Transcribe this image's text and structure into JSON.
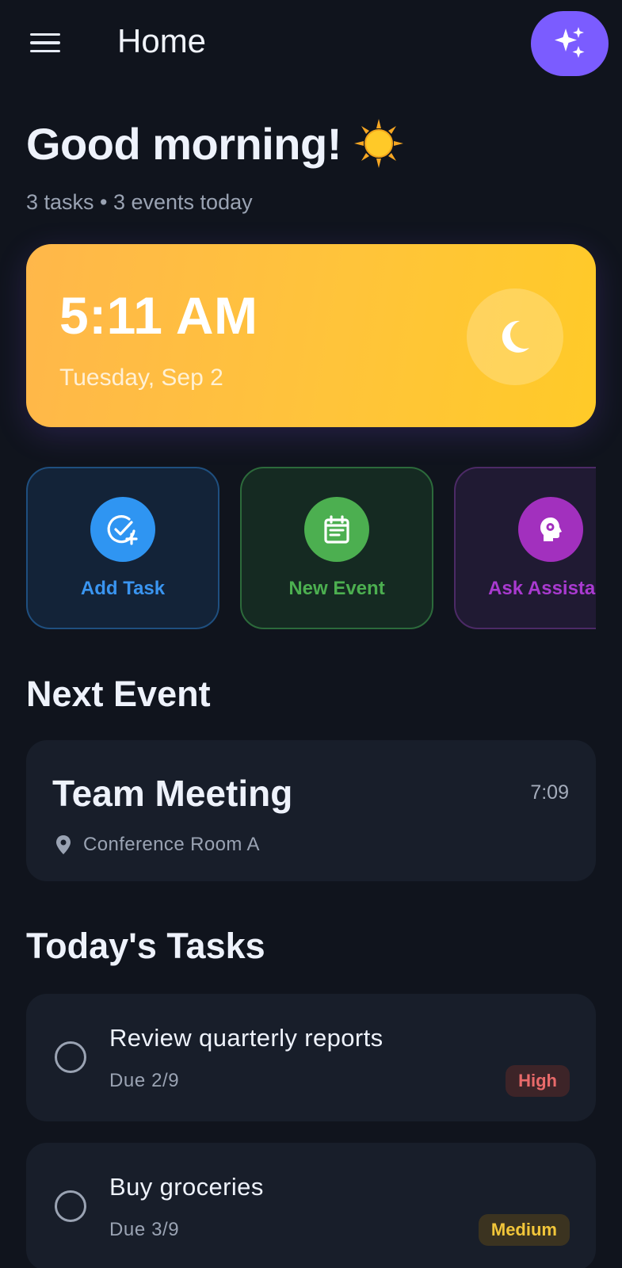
{
  "header": {
    "title": "Home",
    "menu_icon": "hamburger-menu-icon",
    "assistant_icon": "sparkles-icon"
  },
  "greeting": {
    "text": "Good morning!",
    "icon": "sun-icon",
    "summary": "3 tasks • 3 events today"
  },
  "time_card": {
    "time": "5:11 AM",
    "date": "Tuesday, Sep 2",
    "icon": "moon-icon"
  },
  "quick_actions": [
    {
      "label": "Add Task",
      "icon": "add-task-icon",
      "color": "#2f95f2"
    },
    {
      "label": "New Event",
      "icon": "calendar-icon",
      "color": "#4caf50"
    },
    {
      "label": "Ask Assistant",
      "icon": "assistant-head-icon",
      "color": "#a230be"
    }
  ],
  "next_event": {
    "section_title": "Next Event",
    "name": "Team Meeting",
    "time": "7:09",
    "location": "Conference Room A",
    "location_icon": "location-pin-icon"
  },
  "tasks": {
    "section_title": "Today's Tasks",
    "items": [
      {
        "title": "Review quarterly reports",
        "due": "Due 2/9",
        "priority": "High"
      },
      {
        "title": "Buy groceries",
        "due": "Due 3/9",
        "priority": "Medium"
      }
    ]
  },
  "colors": {
    "background": "#10141d",
    "card": "#181e2a",
    "accent_purple": "#7b5cff",
    "time_card_gradient": [
      "#ffb74a",
      "#ffca28"
    ],
    "priority_high": "#e86a6a",
    "priority_medium": "#f2c63a"
  }
}
